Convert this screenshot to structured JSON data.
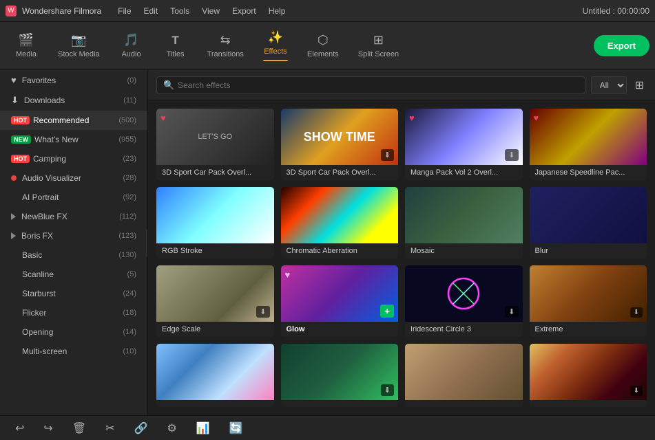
{
  "titlebar": {
    "app_icon": "W",
    "app_name": "Wondershare Filmora",
    "menu": [
      "File",
      "Edit",
      "Tools",
      "View",
      "Export",
      "Help"
    ],
    "title_right": "Untitled : 00:00:00"
  },
  "toolbar": {
    "items": [
      {
        "id": "media",
        "icon": "🎬",
        "label": "Media"
      },
      {
        "id": "stock-media",
        "icon": "📷",
        "label": "Stock Media"
      },
      {
        "id": "audio",
        "icon": "🎵",
        "label": "Audio"
      },
      {
        "id": "titles",
        "icon": "T",
        "label": "Titles"
      },
      {
        "id": "transitions",
        "icon": "↔",
        "label": "Transitions"
      },
      {
        "id": "effects",
        "icon": "✨",
        "label": "Effects"
      },
      {
        "id": "elements",
        "icon": "⬡",
        "label": "Elements"
      },
      {
        "id": "split-screen",
        "icon": "⊞",
        "label": "Split Screen"
      }
    ],
    "export_label": "Export"
  },
  "sidebar": {
    "items": [
      {
        "id": "favorites",
        "label": "Favorites",
        "count": "(0)",
        "icon": "♥",
        "type": "icon"
      },
      {
        "id": "downloads",
        "label": "Downloads",
        "count": "(11)",
        "icon": "⬇",
        "type": "icon"
      },
      {
        "id": "recommended",
        "label": "Recommended",
        "count": "(500)",
        "badge": "HOT",
        "type": "hot"
      },
      {
        "id": "whats-new",
        "label": "What's New",
        "count": "(955)",
        "badge": "NEW",
        "type": "new"
      },
      {
        "id": "camping",
        "label": "Camping",
        "count": "(23)",
        "badge": "HOT",
        "type": "hot"
      },
      {
        "id": "audio-visualizer",
        "label": "Audio Visualizer",
        "count": "(28)",
        "type": "dot"
      },
      {
        "id": "ai-portrait",
        "label": "AI Portrait",
        "count": "(92)",
        "type": "sub"
      },
      {
        "id": "newblue-fx",
        "label": "NewBlue FX",
        "count": "(112)",
        "type": "tri"
      },
      {
        "id": "boris-fx",
        "label": "Boris FX",
        "count": "(123)",
        "type": "tri"
      },
      {
        "id": "basic",
        "label": "Basic",
        "count": "(130)",
        "type": "sub"
      },
      {
        "id": "scanline",
        "label": "Scanline",
        "count": "(5)",
        "type": "sub"
      },
      {
        "id": "starburst",
        "label": "Starburst",
        "count": "(24)",
        "type": "sub"
      },
      {
        "id": "flicker",
        "label": "Flicker",
        "count": "(18)",
        "type": "sub"
      },
      {
        "id": "opening",
        "label": "Opening",
        "count": "(14)",
        "type": "sub"
      },
      {
        "id": "multi-screen",
        "label": "Multi-screen",
        "count": "(10)",
        "type": "sub"
      }
    ]
  },
  "search": {
    "placeholder": "Search effects",
    "filter_label": "All",
    "dropdown_icon": "▾"
  },
  "effects": {
    "items": [
      {
        "id": "effect-1",
        "label": "3D Sport Car Pack Overl...",
        "thumb_class": "thumb-1",
        "has_heart": true,
        "has_dl": false
      },
      {
        "id": "effect-2",
        "label": "3D Sport Car Pack Overl...",
        "thumb_class": "thumb-2",
        "has_heart": false,
        "has_dl": true
      },
      {
        "id": "effect-3",
        "label": "Manga Pack Vol 2 Overl...",
        "thumb_class": "thumb-3",
        "has_heart": true,
        "has_dl": true
      },
      {
        "id": "effect-4",
        "label": "Japanese Speedline Pac...",
        "thumb_class": "thumb-4",
        "has_heart": true,
        "has_dl": false
      },
      {
        "id": "effect-5",
        "label": "RGB Stroke",
        "thumb_class": "thumb-5",
        "has_heart": false,
        "has_dl": false
      },
      {
        "id": "effect-6",
        "label": "Chromatic Aberration",
        "thumb_class": "thumb-6",
        "has_heart": false,
        "has_dl": false
      },
      {
        "id": "effect-7",
        "label": "Mosaic",
        "thumb_class": "thumb-7",
        "has_heart": false,
        "has_dl": false
      },
      {
        "id": "effect-8",
        "label": "Blur",
        "thumb_class": "thumb-8",
        "has_heart": false,
        "has_dl": false
      },
      {
        "id": "effect-9",
        "label": "Edge Scale",
        "thumb_class": "thumb-9",
        "has_heart": false,
        "has_dl": true
      },
      {
        "id": "effect-10",
        "label": "Glow",
        "thumb_class": "thumb-10",
        "has_heart": true,
        "has_dl": false,
        "has_plus": true,
        "label_bold": true
      },
      {
        "id": "effect-11",
        "label": "Iridescent Circle 3",
        "thumb_class": "thumb-11",
        "has_heart": false,
        "has_dl": true
      },
      {
        "id": "effect-12",
        "label": "Extreme",
        "thumb_class": "thumb-12",
        "has_heart": false,
        "has_dl": false
      },
      {
        "id": "effect-13",
        "label": "",
        "thumb_class": "thumb-13",
        "has_heart": false,
        "has_dl": false
      },
      {
        "id": "effect-14",
        "label": "",
        "thumb_class": "thumb-14",
        "has_heart": false,
        "has_dl": true
      },
      {
        "id": "effect-15",
        "label": "",
        "thumb_class": "thumb-15",
        "has_heart": false,
        "has_dl": false
      },
      {
        "id": "effect-16",
        "label": "",
        "thumb_class": "thumb-16",
        "has_heart": false,
        "has_dl": false
      }
    ]
  },
  "bottombar": {
    "buttons": [
      "↩",
      "↪",
      "🗑",
      "✂",
      "🔗",
      "⚙",
      "📊",
      "🔄"
    ]
  }
}
